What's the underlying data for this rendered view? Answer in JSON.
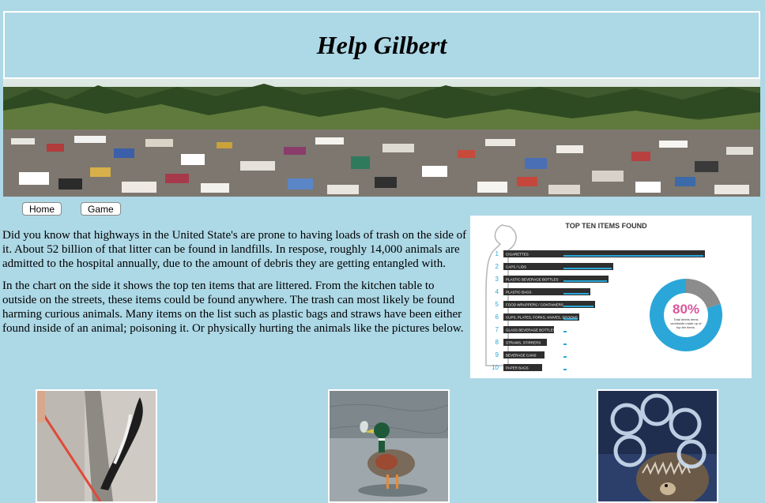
{
  "header": {
    "title": "Help Gilbert"
  },
  "nav": {
    "home_label": "Home",
    "game_label": "Game"
  },
  "content": {
    "paragraph_1": "Did you know that highways in the United State's are prone to having loads of trash on the side of it. About 52 billion of that litter can be found in landfills. In respose, roughly 14,000 animals are admitted to the hospital annually, due to the amount of debris they are getting entangled with.",
    "paragraph_2": "In the chart on the side it shows the top ten items that are littered. From the kitchen table to outside on the streets, these items could be found anywhere. The trash can most likely be found harming curious animals. Many items on the list such as plastic bags and straws have been either found inside of an animal; poisoning it. Or physically hurting the animals like the pictures below."
  },
  "infographic": {
    "title": "TOP TEN ITEMS FOUND",
    "percent": "80%",
    "percent_caption": "Total debris items worldwide made up of top ten items.",
    "percent_value": 0.8,
    "items": [
      {
        "rank": "1",
        "label": "CIGARETTES",
        "share": 0.88
      },
      {
        "rank": "2",
        "label": "CAPS / LIDS",
        "share": 0.48
      },
      {
        "rank": "3",
        "label": "PLASTIC BEVERAGE BOTTLES",
        "share": 0.46
      },
      {
        "rank": "4",
        "label": "PLASTIC BAGS",
        "share": 0.38
      },
      {
        "rank": "5",
        "label": "FOOD WRAPPERS / CONTAINERS",
        "share": 0.4
      },
      {
        "rank": "6",
        "label": "CUPS, PLATES, FORKS, KNIVES, SPOONS",
        "share": 0.33
      },
      {
        "rank": "7",
        "label": "GLASS BEVERAGE BOTTLES",
        "share": 0.22
      },
      {
        "rank": "8",
        "label": "STRAWS, STIRRERS",
        "share": 0.19
      },
      {
        "rank": "9",
        "label": "BEVERAGE CANS",
        "share": 0.18
      },
      {
        "rank": "10",
        "label": "PAPER BAGS",
        "share": 0.17
      }
    ],
    "colors": {
      "bar": "#2f2f2f",
      "accent": "#2aa7d8",
      "ring": "#2aa7d8",
      "ring_rest": "#8c8c8c",
      "percent": "#d9569a"
    }
  }
}
